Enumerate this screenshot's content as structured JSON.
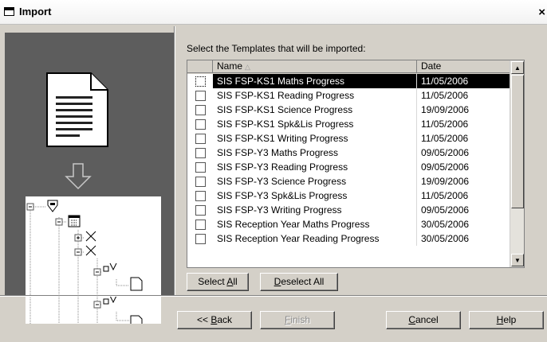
{
  "window": {
    "title": "Import",
    "close_glyph": "×"
  },
  "list": {
    "prompt": "Select the Templates that will be imported:",
    "columns": {
      "name": "Name",
      "date": "Date"
    },
    "sort_indicator": "△",
    "rows": [
      {
        "name": "SIS FSP-KS1 Maths Progress",
        "date": "11/05/2006",
        "selected": true
      },
      {
        "name": "SIS FSP-KS1 Reading Progress",
        "date": "11/05/2006"
      },
      {
        "name": "SIS FSP-KS1 Science Progress",
        "date": "19/09/2006"
      },
      {
        "name": "SIS FSP-KS1 Spk&Lis Progress",
        "date": "11/05/2006"
      },
      {
        "name": "SIS FSP-KS1 Writing Progress",
        "date": "11/05/2006"
      },
      {
        "name": "SIS FSP-Y3 Maths Progress",
        "date": "09/05/2006"
      },
      {
        "name": "SIS FSP-Y3 Reading Progress",
        "date": "09/05/2006"
      },
      {
        "name": "SIS FSP-Y3 Science Progress",
        "date": "19/09/2006"
      },
      {
        "name": "SIS FSP-Y3 Spk&Lis Progress",
        "date": "11/05/2006"
      },
      {
        "name": "SIS FSP-Y3 Writing Progress",
        "date": "09/05/2006"
      },
      {
        "name": "SIS Reception Year Maths Progress",
        "date": "30/05/2006"
      },
      {
        "name": "SIS Reception Year Reading Progress",
        "date": "30/05/2006"
      }
    ]
  },
  "selection_buttons": {
    "select_all": {
      "pre": "Select ",
      "key": "A",
      "post": "ll"
    },
    "deselect_all": {
      "pre": "",
      "key": "D",
      "post": "eselect All"
    }
  },
  "footer": {
    "back": {
      "pre": "<< ",
      "key": "B",
      "post": "ack"
    },
    "finish": {
      "pre": "",
      "key": "F",
      "post": "inish"
    },
    "cancel": {
      "pre": "",
      "key": "C",
      "post": "ancel"
    },
    "help": {
      "pre": "",
      "key": "H",
      "post": "elp"
    }
  },
  "icons": {
    "title": "window-icon",
    "document": "document-icon",
    "arrow": "down-arrow-icon",
    "tree": "tree-view-icon"
  }
}
